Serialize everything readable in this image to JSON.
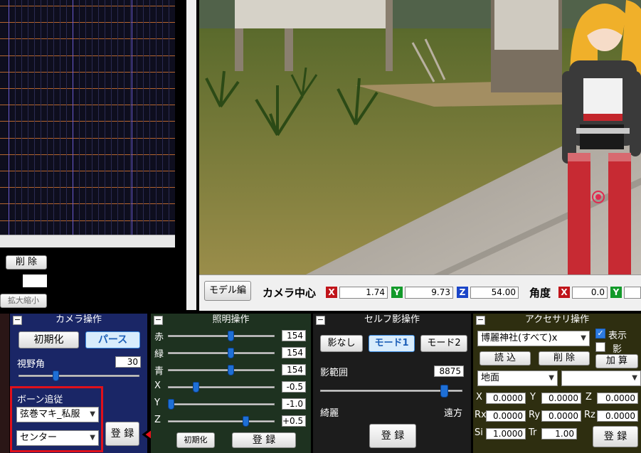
{
  "left": {
    "delete_label": "削 除",
    "zoom_label": "拡大縮小"
  },
  "status_bar": {
    "model_edit": "モデル編",
    "camera_center": "カメラ中心",
    "x_label": "X",
    "x_value": "1.74",
    "y_label": "Y",
    "y_value": "9.73",
    "z_label": "Z",
    "z_value": "54.00",
    "angle": "角度",
    "ax_label": "X",
    "ax_value": "0.0",
    "ay_label": "Y"
  },
  "camera_panel": {
    "title": "カメラ操作",
    "init_btn": "初期化",
    "perspective_btn": "パース",
    "fov_label": "視野角",
    "fov_value": "30",
    "fov_level": 0.3,
    "bone_follow": "ボーン追従",
    "model_select": "弦巻マキ_私服",
    "bone_select": "センター",
    "register_btn": "登 録"
  },
  "light_panel": {
    "title": "照明操作",
    "rows": [
      {
        "label": "赤",
        "value": "154",
        "level": 0.6
      },
      {
        "label": "緑",
        "value": "154",
        "level": 0.6
      },
      {
        "label": "青",
        "value": "154",
        "level": 0.6
      },
      {
        "label": "X",
        "value": "-0.5",
        "level": 0.25
      },
      {
        "label": "Y",
        "value": "-1.0",
        "level": 0.0
      },
      {
        "label": "Z",
        "value": "+0.5",
        "level": 0.75
      }
    ],
    "init_btn": "初期化",
    "register_btn": "登 録"
  },
  "shadow_panel": {
    "title": "セルフ影操作",
    "none_btn": "影なし",
    "mode1_btn": "モード1",
    "mode2_btn": "モード2",
    "range_label": "影範囲",
    "range_value": "8875",
    "range_level": 0.89,
    "near_label": "綺麗",
    "far_label": "遠方",
    "register_btn": "登 録"
  },
  "accessory_panel": {
    "title": "アクセサリ操作",
    "item_select": "博麗神社(すべて)x",
    "show_label": "表示",
    "shadow_label": "影",
    "show_checked": true,
    "shadow_checked": false,
    "load_btn": "読 込",
    "delete_btn": "削 除",
    "add_btn": "加 算",
    "target_select": "地面",
    "target_bone_select": "",
    "x_label": "X",
    "x_value": "0.0000",
    "y_label": "Y",
    "y_value": "0.0000",
    "z_label": "Z",
    "z_value": "0.0000",
    "rx_label": "Rx",
    "rx_value": "0.0000",
    "ry_label": "Ry",
    "ry_value": "0.0000",
    "rz_label": "Rz",
    "rz_value": "0.0000",
    "si_label": "Si",
    "si_value": "1.0000",
    "tr_label": "Tr",
    "tr_value": "1.00",
    "register_btn": "登 録"
  },
  "colors": {
    "camera_panel_bg": "#1a2666",
    "light_panel_bg": "#1e3220",
    "shadow_panel_bg": "#1c1c1c",
    "accessory_panel_bg": "#2e2e10",
    "highlight_box": "#e0101a",
    "arrow": "#e8101a"
  }
}
